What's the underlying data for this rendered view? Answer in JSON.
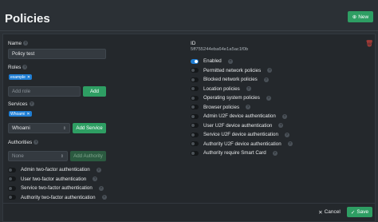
{
  "header": {
    "title": "Policies",
    "new_label": "New"
  },
  "form": {
    "name_label": "Name",
    "name_value": "Policy test",
    "roles_label": "Roles",
    "roles_tags": [
      "example"
    ],
    "add_role_placeholder": "Add role",
    "add_label": "Add",
    "services_label": "Services",
    "services_tags": [
      "Whoami"
    ],
    "service_select_value": "Whoami",
    "add_service_label": "Add Service",
    "authorities_label": "Authorities",
    "authority_select_value": "None",
    "add_authority_label": "Add Authority",
    "left_toggles": [
      {
        "label": "Admin two-factor authentication",
        "on": false
      },
      {
        "label": "User two-factor authentication",
        "on": false
      },
      {
        "label": "Service two-factor authentication",
        "on": false
      },
      {
        "label": "Authority two-factor authentication",
        "on": false
      }
    ],
    "id_label": "ID",
    "id_value": "5ff755244eba64e1a5ac1f0b",
    "right_toggles": [
      {
        "label": "Enabled",
        "on": true
      },
      {
        "label": "Permitted network policies",
        "on": false
      },
      {
        "label": "Blocked network policies",
        "on": false
      },
      {
        "label": "Location policies",
        "on": false
      },
      {
        "label": "Operating system policies",
        "on": false
      },
      {
        "label": "Browser policies",
        "on": false
      },
      {
        "label": "Admin U2F device authentication",
        "on": false
      },
      {
        "label": "User U2F device authentication",
        "on": false
      },
      {
        "label": "Service U2F device authentication",
        "on": false
      },
      {
        "label": "Authority U2F device authentication",
        "on": false
      },
      {
        "label": "Authority require Smart Card",
        "on": false
      }
    ]
  },
  "footer": {
    "cancel_label": "Cancel",
    "save_label": "Save"
  },
  "colors": {
    "accent_green": "#2e9e63",
    "accent_blue": "#1f7ed4",
    "danger_red": "#e0443c"
  }
}
